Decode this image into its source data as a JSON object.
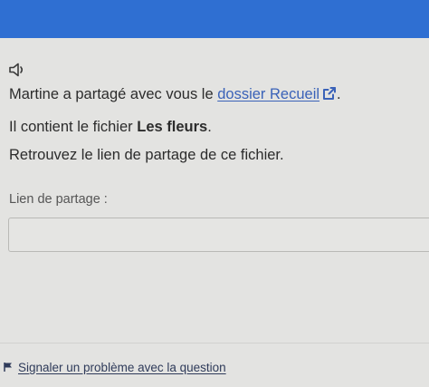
{
  "question": {
    "intro_before": "Martine a partagé avec vous le ",
    "folder_link": "dossier Recueil",
    "intro_after": ".",
    "contains_before": "Il contient le fichier ",
    "file_name": "Les fleurs",
    "contains_after": ".",
    "instruction": "Retrouvez le lien de partage de ce fichier."
  },
  "form": {
    "label": "Lien de partage :",
    "value": "",
    "placeholder": ""
  },
  "footer": {
    "report_link": "Signaler un problème avec la question"
  },
  "icons": {
    "audio": "speaker-icon",
    "external": "external-link-icon",
    "report": "flag-icon"
  },
  "colors": {
    "top_bar": "#2f6fd2",
    "link": "#3a62b8"
  }
}
